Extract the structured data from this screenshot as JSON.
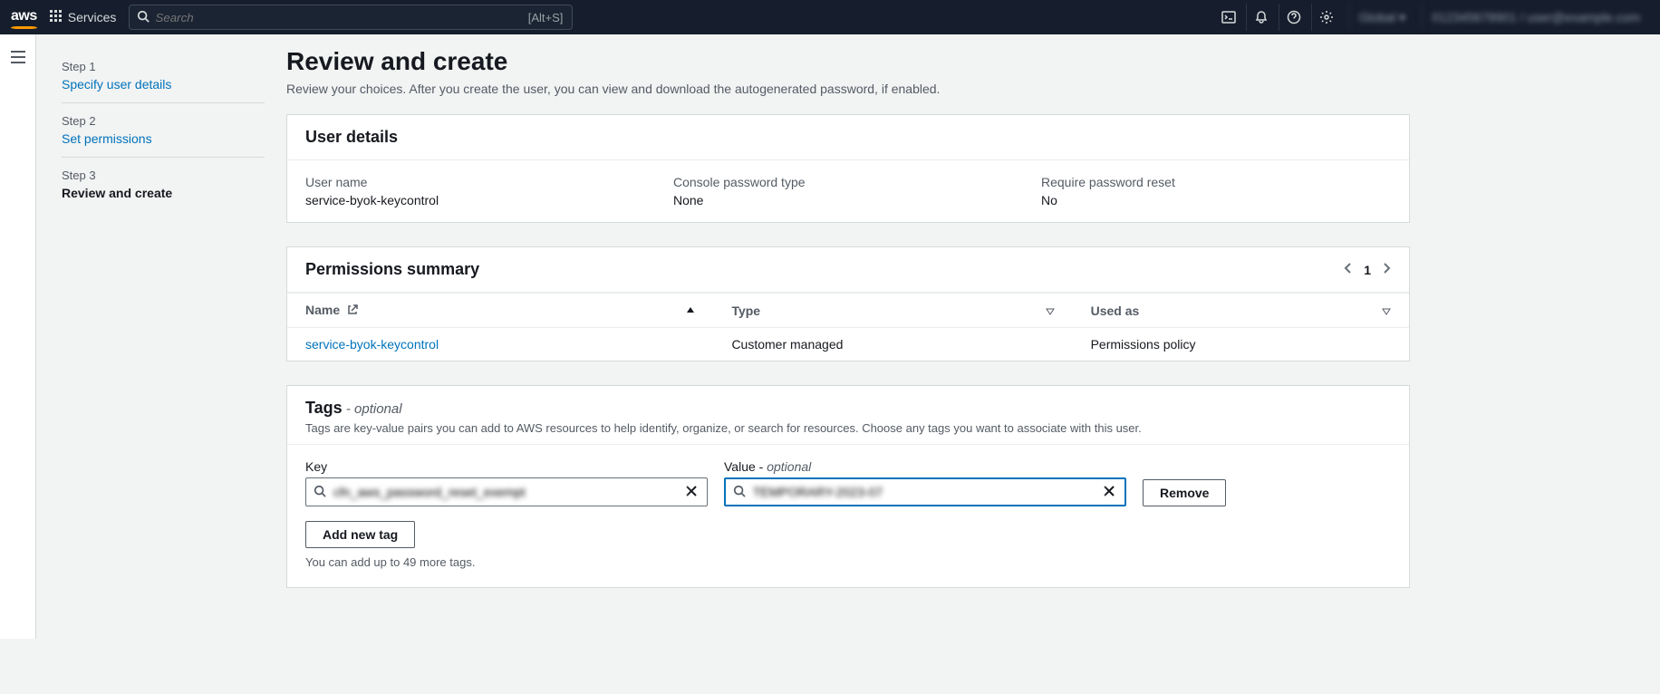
{
  "nav": {
    "logo": "aws",
    "services_label": "Services",
    "search_placeholder": "Search",
    "search_shortcut": "[Alt+S]",
    "region": "Global ▾",
    "account": "012345678901 / user@example.com"
  },
  "wizard": {
    "steps": [
      {
        "step": "Step 1",
        "title": "Specify user details",
        "link": true
      },
      {
        "step": "Step 2",
        "title": "Set permissions",
        "link": true
      },
      {
        "step": "Step 3",
        "title": "Review and create",
        "current": true
      }
    ]
  },
  "page": {
    "title": "Review and create",
    "subtitle": "Review your choices. After you create the user, you can view and download the autogenerated password, if enabled."
  },
  "user_details": {
    "heading": "User details",
    "fields": [
      {
        "label": "User name",
        "value": "service-byok-keycontrol"
      },
      {
        "label": "Console password type",
        "value": "None"
      },
      {
        "label": "Require password reset",
        "value": "No"
      }
    ]
  },
  "permissions": {
    "heading": "Permissions summary",
    "page": "1",
    "columns": [
      "Name",
      "Type",
      "Used as"
    ],
    "rows": [
      {
        "name": "service-byok-keycontrol",
        "type": "Customer managed",
        "used_as": "Permissions policy"
      }
    ]
  },
  "tags": {
    "heading": "Tags",
    "optional": " - optional",
    "desc": "Tags are key-value pairs you can add to AWS resources to help identify, organize, or search for resources. Choose any tags you want to associate with this user.",
    "key_label": "Key",
    "value_label": "Value - ",
    "value_optional": "optional",
    "key_input": "cfn_aws_password_reset_exempt",
    "value_input": "TEMPORARY-2023-07",
    "remove": "Remove",
    "add": "Add new tag",
    "hint": "You can add up to 49 more tags."
  }
}
